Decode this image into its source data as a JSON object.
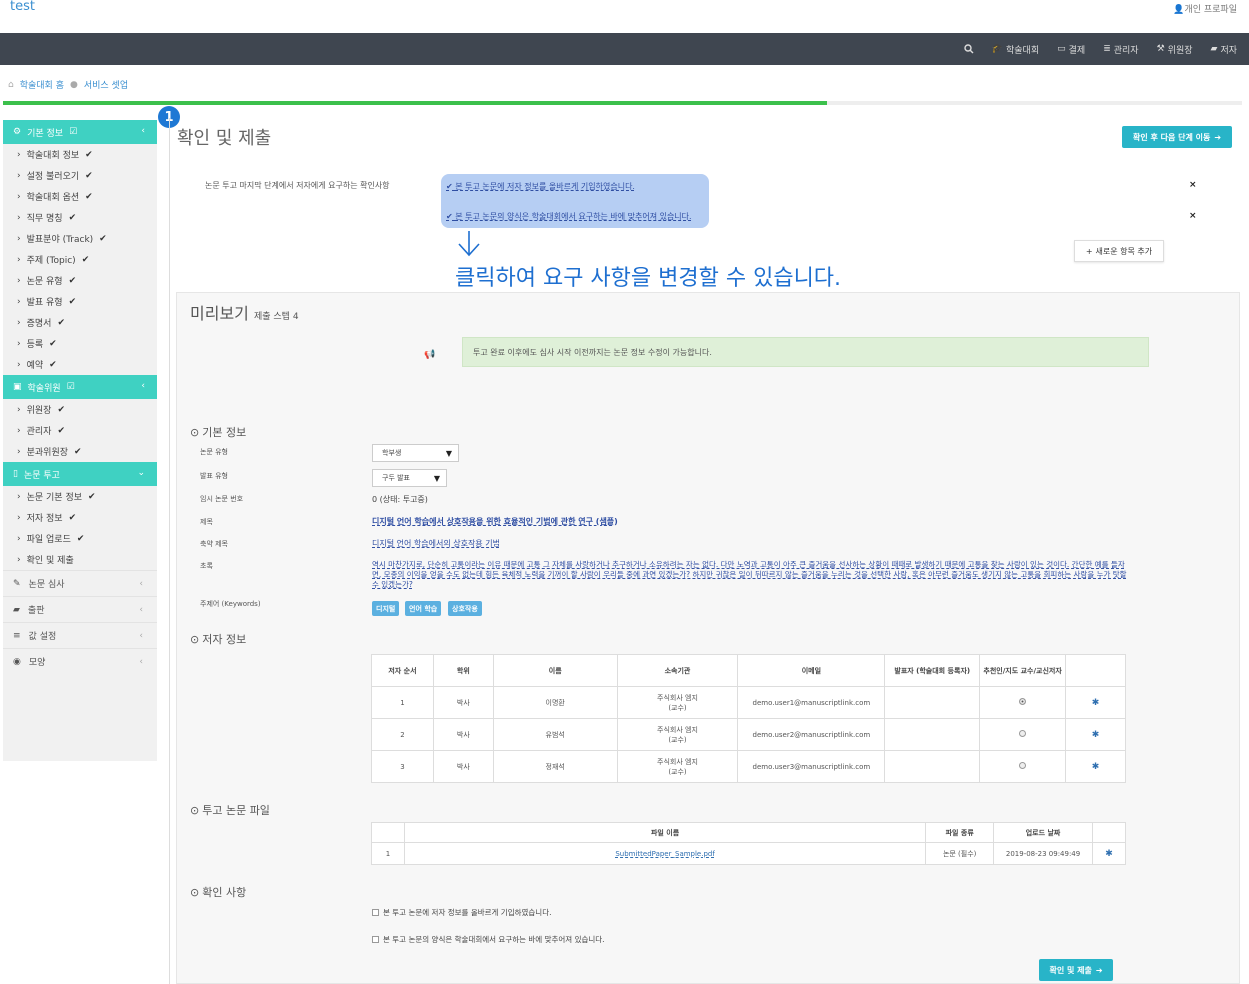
{
  "header": {
    "brand": "test",
    "profile": "개인 프로파일"
  },
  "nav": [
    {
      "icon": "mortarboard-icon",
      "label": "학술대회"
    },
    {
      "icon": "credit-card-icon",
      "label": "결제"
    },
    {
      "icon": "list-icon",
      "label": "관리자"
    },
    {
      "icon": "gavel-icon",
      "label": "위원장"
    },
    {
      "icon": "book-icon",
      "label": "저자"
    }
  ],
  "breadcrumb": {
    "home": "학술대회 홈",
    "current": "서비스 셋업"
  },
  "progress": {
    "percent": 66.5
  },
  "sidebar": {
    "sec1": {
      "title": "기본 정보",
      "items": [
        "학술대회 정보",
        "설정 불러오기",
        "학술대회 옵션",
        "직무 명칭",
        "발표분야 (Track)",
        "주제 (Topic)",
        "논문 유형",
        "발표 유형",
        "증명서",
        "등록",
        "예약"
      ]
    },
    "sec2": {
      "title": "학술위원",
      "items": [
        "위원장",
        "관리자",
        "분과위원장"
      ]
    },
    "sec3": {
      "title": "논문 투고",
      "items": [
        "논문 기본 정보",
        "저자 정보",
        "파일 업로드",
        "확인 및 제출"
      ]
    },
    "plain": [
      "논문 심사",
      "출판",
      "값 설정",
      "모양"
    ]
  },
  "badge": "1",
  "page": {
    "title": "확인 및 제출",
    "next_button": "확인 후 다음 단계 이동",
    "req_label": "논문 투고 마지막 단계에서 저자에게 요구하는 확인사항",
    "req_items": [
      "본 투고 논문에 저자 정보를 올바르게 기입하였습니다.",
      "본 투고 논문의 양식은 학술대회에서 요구하는 바에 맞추어져 있습니다."
    ],
    "close_symbol": "×",
    "add_button": "새로운 항목 추가",
    "annotation": "클릭하여 요구 사항을 변경할 수 있습니다."
  },
  "preview": {
    "title": "미리보기",
    "subtitle": "제출 스텝 4",
    "notice": "투고 완료 이후에도 심사 시작 이전까지는 논문 정보 수정이 가능합니다.",
    "basic": {
      "title": "기본 정보",
      "paper_type_label": "논문 유형",
      "paper_type_value": "학부생",
      "presentation_type_label": "발표 유형",
      "presentation_type_value": "구두 발표",
      "temp_no_label": "임시 논문 번호",
      "temp_no_value": "0 (상태: 투고중)",
      "title_label": "제목",
      "title_value": "디지털 언어 학습에서 상호작용을 위한 효율적인 기법에 관한 연구 (샘플)",
      "short_title_label": "축약 제목",
      "short_title_value": "디지털 언어 학습에서의 상호작용 기법",
      "abstract_label": "초록",
      "abstract_value": "역시 마찬가지로, 단순히 고통이라는 이유 때문에 고통 그 자체를 사랑하거나 추구하거나 소유하려는 자는 없다. 다만 노역과 고통이 아주 큰 즐거움을 선사하는 상황이 때때로 발생하기 때문에 고통을 찾는 사람이 있는 것이다. 간단한 예를 들자면, 모종의 이익을 얻을 수도 없는데 힘든 육체적 노력을 기꺼이 할 사람이 우리들 중에 과연 있겠는가? 하지만 귀찮은 일이 뒤따르지 않는 즐거움을 누리는 것을 선택한 사람, 혹은 아무런 즐거움도 생기지 않는 고통을 회피하는 사람을 누가 탓할 수 있겠는가?",
      "keywords_label": "주제어 (Keywords)",
      "keywords": [
        "디지털",
        "언어 학습",
        "상호작용"
      ]
    },
    "authors": {
      "title": "저자 정보",
      "headers": [
        "저자 순서",
        "학위",
        "이름",
        "소속기관",
        "이메일",
        "발표자 (학술대회 등록자)",
        "추천인/지도 교수/교신저자",
        ""
      ],
      "rows": [
        {
          "order": "1",
          "degree": "박사",
          "name": "이명환",
          "org": "주식회사 엠지",
          "org2": "(교수)",
          "email": "demo.user1@manuscriptlink.com"
        },
        {
          "order": "2",
          "degree": "박사",
          "name": "유범석",
          "org": "주식회사 엠지",
          "org2": "(교수)",
          "email": "demo.user2@manuscriptlink.com"
        },
        {
          "order": "3",
          "degree": "박사",
          "name": "정재석",
          "org": "주식회사 엠지",
          "org2": "(교수)",
          "email": "demo.user3@manuscriptlink.com"
        }
      ]
    },
    "files": {
      "title": "투고 논문 파일",
      "headers": [
        "",
        "파일 이름",
        "파일 종류",
        "업로드 날짜",
        ""
      ],
      "rows": [
        {
          "no": "1",
          "name": "SubmittedPaper_Sample.pdf",
          "type": "논문 (필수)",
          "date": "2019-08-23 09:49:49"
        }
      ]
    },
    "confirm": {
      "title": "확인 사항",
      "items": [
        "본 투고 논문에 저자 정보를 올바르게 기입하였습니다.",
        "본 투고 논문의 양식은 학술대회에서 요구하는 바에 맞추어져 있습니다."
      ],
      "submit_button": "확인 및 제출"
    }
  }
}
